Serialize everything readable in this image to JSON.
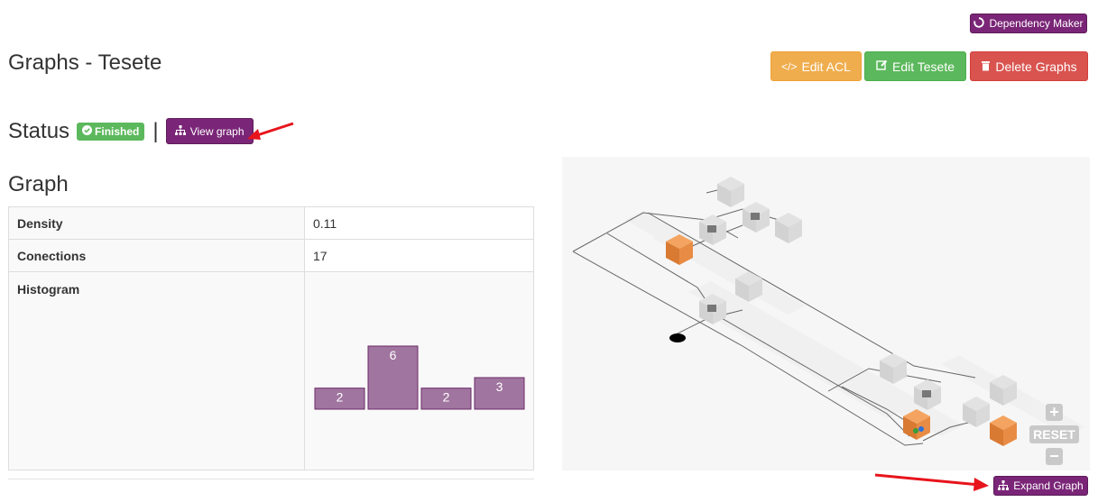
{
  "header": {
    "dependency_maker_label": "Dependency Maker",
    "page_title": "Graphs - Tesete",
    "edit_acl_label": "Edit ACL",
    "edit_label": "Edit Tesete",
    "delete_label": "Delete Graphs"
  },
  "status": {
    "label": "Status",
    "badge": "Finished",
    "separator": "|",
    "view_graph_label": "View graph"
  },
  "graph_section": {
    "heading": "Graph",
    "rows": [
      {
        "key": "Density",
        "value": "0.11"
      },
      {
        "key": "Conections",
        "value": "17"
      },
      {
        "key": "Histogram",
        "value": ""
      }
    ]
  },
  "chart_data": {
    "type": "bar",
    "values": [
      2,
      6,
      2,
      3
    ],
    "colors": {
      "fill": "#a0759f",
      "stroke": "#6b2b68",
      "label": "#ffffff"
    }
  },
  "graph_view": {
    "zoom_in_label": "+",
    "reset_label": "RESET",
    "zoom_out_label": "−",
    "expand_label": "Expand Graph"
  },
  "colors": {
    "purple": "#7a2577",
    "orange": "#f0ad4e",
    "green": "#5cb85c",
    "red": "#d9534f",
    "annotation_arrow": "#e8141c"
  }
}
